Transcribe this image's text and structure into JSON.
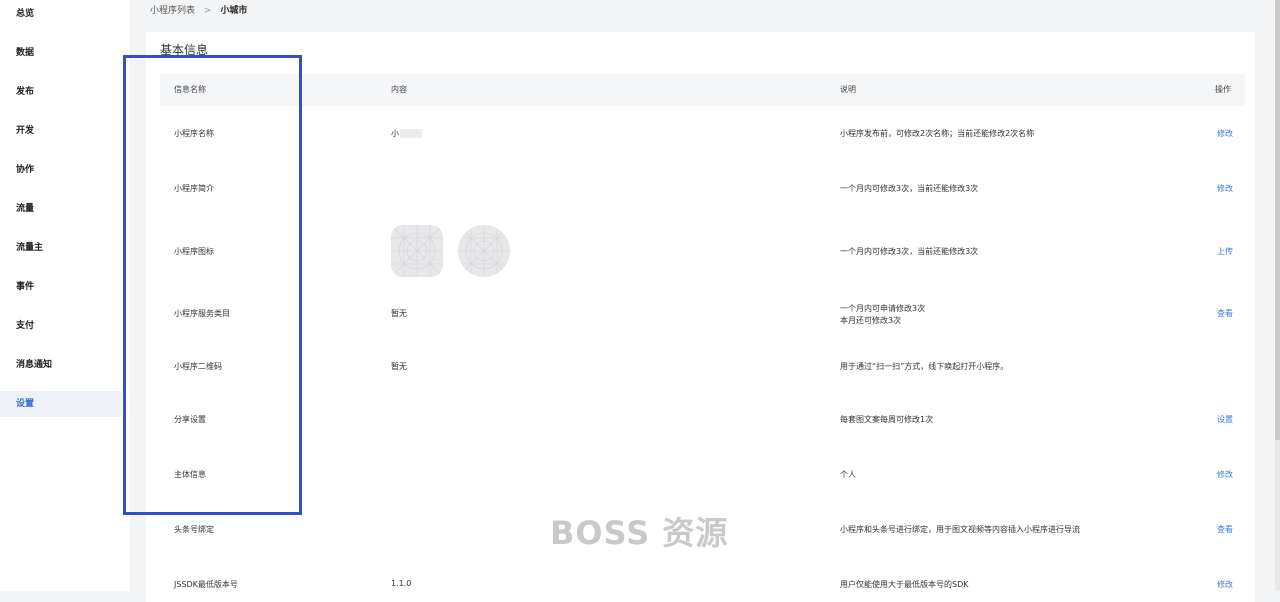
{
  "sidebar": {
    "items": [
      {
        "label": "总览"
      },
      {
        "label": "数据"
      },
      {
        "label": "发布"
      },
      {
        "label": "开发"
      },
      {
        "label": "协作"
      },
      {
        "label": "流量"
      },
      {
        "label": "流量主"
      },
      {
        "label": "事件"
      },
      {
        "label": "支付"
      },
      {
        "label": "消息通知"
      },
      {
        "label": "设置"
      }
    ],
    "active_label": "设置"
  },
  "breadcrumb": {
    "parent": "小程序列表",
    "separator": ">",
    "current": "小城市"
  },
  "section": {
    "title": "基本信息"
  },
  "table": {
    "headers": {
      "name": "信息名称",
      "content": "内容",
      "desc": "说明",
      "action": "操作"
    },
    "rows": [
      {
        "name": "小程序名称",
        "content": "小",
        "desc": "小程序发布前，可修改2次名称；当前还能修改2次名称",
        "desc2": "",
        "action": "修改"
      },
      {
        "name": "小程序简介",
        "content": "",
        "desc": "一个月内可修改3次，当前还能修改3次",
        "desc2": "",
        "action": "修改"
      },
      {
        "name": "小程序图标",
        "content": "",
        "desc": "一个月内可修改3次，当前还能修改3次",
        "desc2": "",
        "action": "上传"
      },
      {
        "name": "小程序服务类目",
        "content": "暂无",
        "desc": "一个月内可申请修改3次",
        "desc2": "本月还可修改3次",
        "action": "查看"
      },
      {
        "name": "小程序二维码",
        "content": "暂无",
        "desc": "用于通过“扫一扫”方式，线下唤起打开小程序。",
        "desc2": "",
        "action": ""
      },
      {
        "name": "分享设置",
        "content": "",
        "desc": "每套图文案每周可修改1次",
        "desc2": "",
        "action": "设置"
      },
      {
        "name": "主体信息",
        "content": "",
        "desc": "个人",
        "desc2": "",
        "action": "修改"
      },
      {
        "name": "头条号绑定",
        "content": "",
        "desc": "小程序和头条号进行绑定，用于图文视频等内容插入小程序进行导流",
        "desc2": "",
        "action": "查看"
      },
      {
        "name": "JSSDK最低版本号",
        "content": "1.1.0",
        "desc": "用户仅能使用大于最低版本号的SDK",
        "desc2": "",
        "action": "修改"
      }
    ]
  },
  "watermark": "BOSS 资源",
  "colors": {
    "accent": "#3a7be0",
    "highlight_box": "#3050c8",
    "active_sidebar_bg": "#eef2f8"
  }
}
